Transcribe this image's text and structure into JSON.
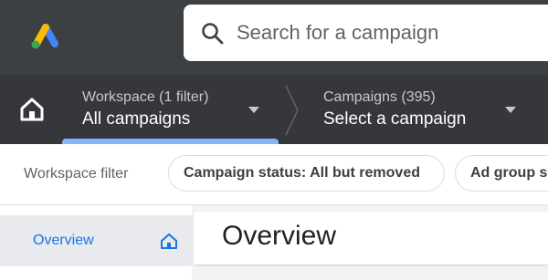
{
  "search": {
    "placeholder": "Search for a campaign"
  },
  "breadcrumb": {
    "workspace": {
      "label": "Workspace (1 filter)",
      "value": "All campaigns"
    },
    "campaigns": {
      "label": "Campaigns (395)",
      "value": "Select a campaign"
    }
  },
  "filters": {
    "label": "Workspace filter",
    "chips": [
      "Campaign status: All but removed",
      "Ad group s"
    ]
  },
  "sidebar": {
    "items": [
      {
        "label": "Overview",
        "icon": "home-icon"
      }
    ]
  },
  "page": {
    "title": "Overview"
  },
  "colors": {
    "topbar": "#3c4043",
    "navbar": "#35373a",
    "accent": "#1a73e8",
    "underline": "#8ab4f8",
    "logo_yellow": "#fbbc04",
    "logo_blue": "#4285f4",
    "logo_green": "#34a853"
  }
}
